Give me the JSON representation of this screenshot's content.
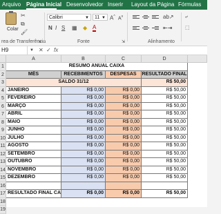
{
  "ribbon_tabs": [
    "Arquivo",
    "Página Inicial",
    "Desenvolvedor",
    "Inserir",
    "Layout da Página",
    "Fórmulas"
  ],
  "ribbon": {
    "paste_label": "Colar",
    "clipboard_label": "rea de Transferência",
    "font_name": "Calibri",
    "font_size": "11",
    "font_group_label": "Fonte",
    "align_group_label": "Alinhamento",
    "bold_glyph": "N",
    "italic_glyph": "I",
    "underline_glyph": "S",
    "font_color_glyph": "A"
  },
  "formula_bar": {
    "name_box": "H9",
    "fx_label": "fx",
    "formula": ""
  },
  "columns": [
    "A",
    "B",
    "C",
    "D"
  ],
  "rows": [
    "1",
    "2",
    "3",
    "4",
    "5",
    "6",
    "7",
    "8",
    "9",
    "10",
    "11",
    "12",
    "13",
    "14",
    "15",
    "16",
    "17",
    "18",
    "19"
  ],
  "sheet": {
    "title": "RESUMO ANUAL CAIXA",
    "headers": {
      "mes": "MÊS",
      "recebimentos": "RECEBIMENTOS",
      "despesas": "DESPESAS",
      "resultado": "RESULTADO FINAL"
    },
    "saldo_label": "SALDO 31/12",
    "saldo_value": "R$ 50,00",
    "months": [
      {
        "name": "JANEIRO",
        "receb": "R$ 0,00",
        "desp": "R$ 0,00",
        "res": "R$ 50,00"
      },
      {
        "name": "FEVEREIRO",
        "receb": "R$ 0,00",
        "desp": "R$ 0,00",
        "res": "R$ 50,00"
      },
      {
        "name": "MARÇO",
        "receb": "R$ 0,00",
        "desp": "R$ 0,00",
        "res": "R$ 50,00"
      },
      {
        "name": "ABRIL",
        "receb": "R$ 0,00",
        "desp": "R$ 0,00",
        "res": "R$ 50,00"
      },
      {
        "name": "MAIO",
        "receb": "R$ 0,00",
        "desp": "R$ 0,00",
        "res": "R$ 50,00"
      },
      {
        "name": "JUNHO",
        "receb": "R$ 0,00",
        "desp": "R$ 0,00",
        "res": "R$ 50,00"
      },
      {
        "name": "JULHO",
        "receb": "R$ 0,00",
        "desp": "R$ 0,00",
        "res": "R$ 50,00"
      },
      {
        "name": "AGOSTO",
        "receb": "R$ 0,00",
        "desp": "R$ 0,00",
        "res": "R$ 50,00"
      },
      {
        "name": "SETEMBRO",
        "receb": "R$ 0,00",
        "desp": "R$ 0,00",
        "res": "R$ 50,00"
      },
      {
        "name": "OUTUBRO",
        "receb": "R$ 0,00",
        "desp": "R$ 0,00",
        "res": "R$ 50,00"
      },
      {
        "name": "NOVEMBRO",
        "receb": "R$ 0,00",
        "desp": "R$ 0,00",
        "res": "R$ 50,00"
      },
      {
        "name": "DEZEMBRO",
        "receb": "R$ 0,00",
        "desp": "R$ 0,00",
        "res": "R$ 50,00"
      }
    ],
    "final_label": "RESULTADO FINAL CAIXA",
    "final_receb": "R$ 0,00",
    "final_desp": "R$ 0,00",
    "final_res": "R$ 50,00"
  },
  "colors": {
    "brand_green": "#217346",
    "receb_fill": "#d9e1f2",
    "desp_fill": "#f8cbad",
    "saldo_fill": "#fce4d6",
    "header_fill": "#d0d0d0"
  }
}
